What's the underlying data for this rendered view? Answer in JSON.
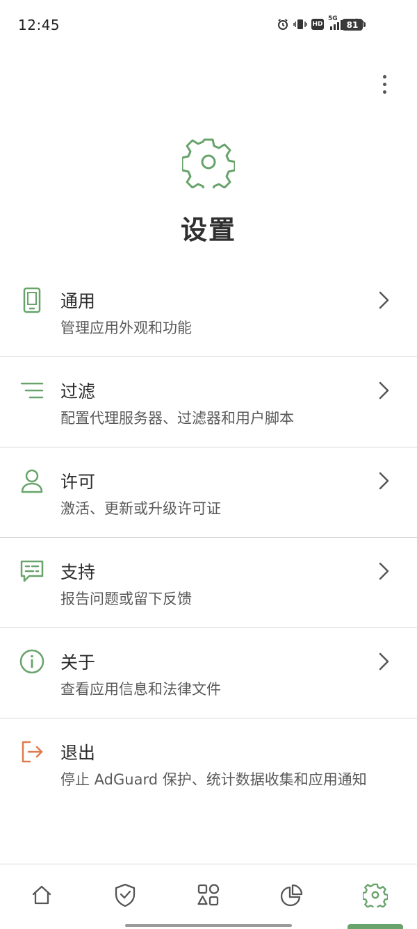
{
  "status_bar": {
    "time": "12:45",
    "network": "5G",
    "hd_label": "HD",
    "battery": "81"
  },
  "page": {
    "title": "设置",
    "more_icon": "more-vertical-icon",
    "hero_icon": "gear-icon"
  },
  "colors": {
    "accent": "#67a36a",
    "danger": "#e07a4f",
    "text_primary": "#2c2c2c",
    "text_secondary": "#5a5a5a",
    "divider": "#d9d9d9"
  },
  "settings": {
    "items": [
      {
        "title": "通用",
        "subtitle": "管理应用外观和功能",
        "icon": "phone-icon"
      },
      {
        "title": "过滤",
        "subtitle": "配置代理服务器、过滤器和用户脚本",
        "icon": "filter-lines-icon"
      },
      {
        "title": "许可",
        "subtitle": "激活、更新或升级许可证",
        "icon": "user-icon"
      },
      {
        "title": "支持",
        "subtitle": "报告问题或留下反馈",
        "icon": "message-icon"
      },
      {
        "title": "关于",
        "subtitle": "查看应用信息和法律文件",
        "icon": "info-icon"
      },
      {
        "title": "退出",
        "subtitle": "停止 AdGuard 保护、统计数据收集和应用通知",
        "icon": "exit-icon"
      }
    ]
  },
  "bottom_nav": {
    "items": [
      {
        "icon": "home-icon",
        "active": false
      },
      {
        "icon": "shield-check-icon",
        "active": false
      },
      {
        "icon": "apps-grid-icon",
        "active": false
      },
      {
        "icon": "pie-chart-icon",
        "active": false
      },
      {
        "icon": "gear-icon",
        "active": true
      }
    ]
  }
}
